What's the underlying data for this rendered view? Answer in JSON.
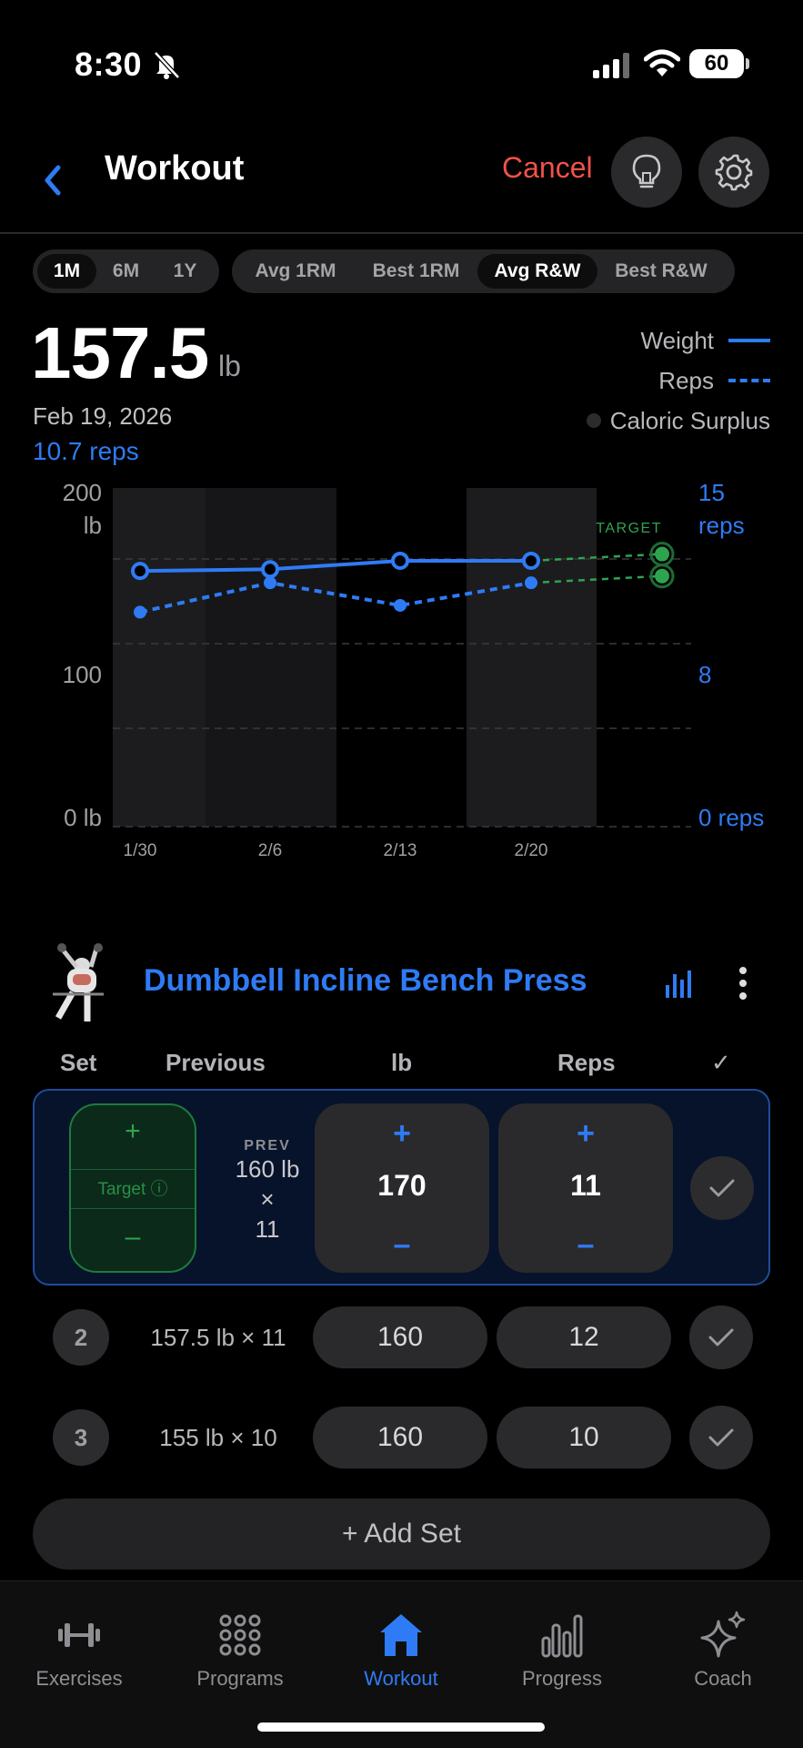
{
  "status": {
    "time": "8:30",
    "battery": "60"
  },
  "header": {
    "title": "Workout",
    "cancel_label": "Cancel"
  },
  "range_tabs": [
    {
      "label": "1M",
      "active": true
    },
    {
      "label": "6M",
      "active": false
    },
    {
      "label": "1Y",
      "active": false
    }
  ],
  "metric_tabs": [
    {
      "label": "Avg 1RM",
      "active": false
    },
    {
      "label": "Best 1RM",
      "active": false
    },
    {
      "label": "Avg R&W",
      "active": true
    },
    {
      "label": "Best R&W",
      "active": false
    }
  ],
  "summary": {
    "value": "157.5",
    "unit": "lb",
    "date": "Feb 19, 2026",
    "reps": "10.7 reps"
  },
  "legend": {
    "weight": "Weight",
    "reps": "Reps",
    "surplus": "Caloric Surplus"
  },
  "colors": {
    "accent": "#2f7bf5",
    "target": "#2ea44f",
    "cancel": "#f0524a"
  },
  "chart_data": {
    "type": "line",
    "x_labels": [
      "1/30",
      "2/6",
      "2/13",
      "2/20"
    ],
    "left_axis": {
      "ticks": [
        "200\nlb",
        "100",
        "0 lb"
      ],
      "range": [
        0,
        200
      ]
    },
    "right_axis": {
      "ticks": [
        "15\nreps",
        "8",
        "0 reps"
      ],
      "range": [
        0,
        15
      ]
    },
    "target_label": "TARGET",
    "series": [
      {
        "name": "Weight",
        "style": "solid",
        "values": [
          151,
          152,
          157,
          157
        ],
        "target": 161
      },
      {
        "name": "Reps",
        "style": "dashed",
        "values": [
          9.5,
          10.8,
          9.8,
          10.8
        ],
        "target": 11.1
      }
    ],
    "grid": true
  },
  "exercise": {
    "name": "Dumbbell Incline Bench Press",
    "columns": {
      "set": "Set",
      "previous": "Previous",
      "weight": "lb",
      "reps": "Reps",
      "done": "✓"
    },
    "active_set": {
      "target_label": "Target ⓘ",
      "plus": "+",
      "minus": "–",
      "prev_label": "PREV",
      "prev_weight": "160 lb",
      "prev_x": "×",
      "prev_reps": "11",
      "weight": "170",
      "reps": "11"
    },
    "sets": [
      {
        "number": "2",
        "previous": "157.5 lb × 11",
        "weight": "160",
        "reps": "12"
      },
      {
        "number": "3",
        "previous": "155 lb × 10",
        "weight": "160",
        "reps": "10"
      }
    ],
    "add_set_label": "+ Add Set"
  },
  "tabs": [
    {
      "label": "Exercises",
      "icon": "dumbbell-icon",
      "active": false
    },
    {
      "label": "Programs",
      "icon": "grid-dots-icon",
      "active": false
    },
    {
      "label": "Workout",
      "icon": "home-icon",
      "active": true
    },
    {
      "label": "Progress",
      "icon": "bar-chart-icon",
      "active": false
    },
    {
      "label": "Coach",
      "icon": "sparkles-icon",
      "active": false
    }
  ]
}
